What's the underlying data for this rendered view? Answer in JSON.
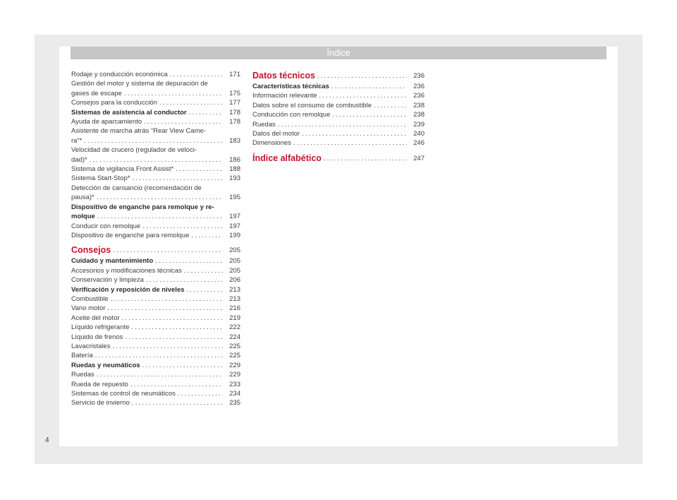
{
  "header": {
    "title": "Índice"
  },
  "page_number": "4",
  "left_column": [
    {
      "lines": [
        "Rodaje y conducción económica"
      ],
      "page": "171",
      "style": "normal"
    },
    {
      "lines": [
        "Gestión del motor y sistema de depuración de",
        "gases de escape"
      ],
      "page": "175",
      "style": "normal"
    },
    {
      "lines": [
        "Consejos para la conducción"
      ],
      "page": "177",
      "style": "normal"
    },
    {
      "lines": [
        "Sistemas de asistencia al conductor"
      ],
      "page": "178",
      "style": "bold"
    },
    {
      "lines": [
        "Ayuda de aparcamiento"
      ],
      "page": "178",
      "style": "normal"
    },
    {
      "lines": [
        "Asistente de marcha atrás “Rear View Came-",
        "ra”*"
      ],
      "page": "183",
      "style": "normal"
    },
    {
      "lines": [
        "Velocidad de crucero (regulador de veloci-",
        "dad)*"
      ],
      "page": "186",
      "style": "normal"
    },
    {
      "lines": [
        "Sistema de vigilancia Front Assist*"
      ],
      "page": "188",
      "style": "normal"
    },
    {
      "lines": [
        "Sistema Start-Stop*"
      ],
      "page": "193",
      "style": "normal"
    },
    {
      "lines": [
        "Detección de cansancio (recomendación de",
        "pausa)*"
      ],
      "page": "195",
      "style": "normal"
    },
    {
      "lines": [
        "Dispositivo de enganche para remolque y re-",
        "molque"
      ],
      "page": "197",
      "style": "bold"
    },
    {
      "lines": [
        "Conducir con remolque"
      ],
      "page": "197",
      "style": "normal"
    },
    {
      "lines": [
        "Dispositivo de enganche para remolque"
      ],
      "page": "199",
      "style": "normal"
    },
    {
      "lines": [
        "Consejos"
      ],
      "page": "205",
      "style": "section"
    },
    {
      "lines": [
        "Cuidado y mantenimiento"
      ],
      "page": "205",
      "style": "bold"
    },
    {
      "lines": [
        "Accesorios y modificaciones técnicas"
      ],
      "page": "205",
      "style": "normal"
    },
    {
      "lines": [
        "Conservación y limpieza"
      ],
      "page": "206",
      "style": "normal"
    },
    {
      "lines": [
        "Verificación y reposición de niveles"
      ],
      "page": "213",
      "style": "bold"
    },
    {
      "lines": [
        "Combustible"
      ],
      "page": "213",
      "style": "normal"
    },
    {
      "lines": [
        "Vano motor"
      ],
      "page": "216",
      "style": "normal"
    },
    {
      "lines": [
        "Aceite del motor"
      ],
      "page": "219",
      "style": "normal"
    },
    {
      "lines": [
        "Líquido refrigerante"
      ],
      "page": "222",
      "style": "normal"
    },
    {
      "lines": [
        "Líquido de frenos"
      ],
      "page": "224",
      "style": "normal"
    },
    {
      "lines": [
        "Lavacristales"
      ],
      "page": "225",
      "style": "normal"
    },
    {
      "lines": [
        "Batería"
      ],
      "page": "225",
      "style": "normal"
    },
    {
      "lines": [
        "Ruedas y neumáticos"
      ],
      "page": "229",
      "style": "bold"
    },
    {
      "lines": [
        "Ruedas"
      ],
      "page": "229",
      "style": "normal"
    },
    {
      "lines": [
        "Rueda de repuesto"
      ],
      "page": "233",
      "style": "normal"
    },
    {
      "lines": [
        "Sistemas de control de neumáticos"
      ],
      "page": "234",
      "style": "normal"
    },
    {
      "lines": [
        "Servicio de invierno"
      ],
      "page": "235",
      "style": "normal"
    }
  ],
  "right_column": [
    {
      "lines": [
        "Datos técnicos"
      ],
      "page": "236",
      "style": "section"
    },
    {
      "lines": [
        "Características técnicas"
      ],
      "page": "236",
      "style": "bold"
    },
    {
      "lines": [
        "Información relevante"
      ],
      "page": "236",
      "style": "normal"
    },
    {
      "lines": [
        "Datos sobre el consumo de combustible"
      ],
      "page": "238",
      "style": "normal"
    },
    {
      "lines": [
        "Conducción con remolque"
      ],
      "page": "238",
      "style": "normal"
    },
    {
      "lines": [
        "Ruedas"
      ],
      "page": "239",
      "style": "normal"
    },
    {
      "lines": [
        "Datos del motor"
      ],
      "page": "240",
      "style": "normal"
    },
    {
      "lines": [
        "Dimensiones"
      ],
      "page": "246",
      "style": "normal"
    },
    {
      "lines": [
        "Índice alfabético"
      ],
      "page": "247",
      "style": "section"
    }
  ]
}
